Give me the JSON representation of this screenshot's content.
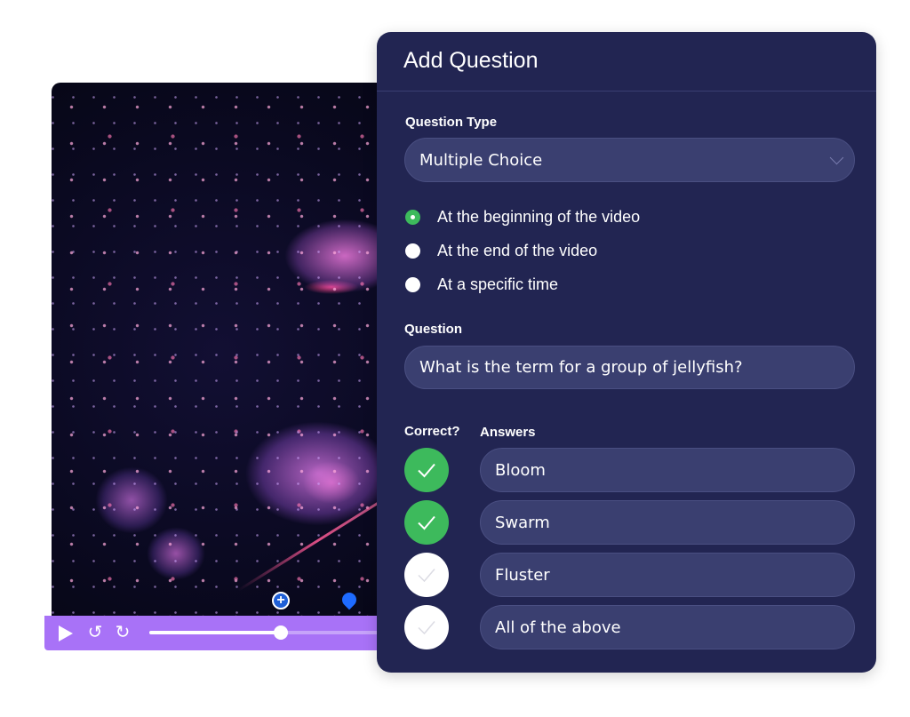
{
  "video": {
    "controls": {
      "play_icon": "play-icon",
      "rewind_icon": "rotate-ccw-icon",
      "forward_icon": "rotate-cw-icon",
      "rewind_glyph": "↺",
      "forward_glyph": "↻",
      "progress_fraction": 0.51
    },
    "markers": [
      {
        "type": "add-question-marker",
        "glyph": "+"
      },
      {
        "type": "question-pin-marker"
      }
    ]
  },
  "panel": {
    "title": "Add Question",
    "question_type": {
      "label": "Question Type",
      "selected": "Multiple Choice"
    },
    "timing_options": [
      {
        "label": "At the beginning of the video",
        "selected": true
      },
      {
        "label": "At the end of the video",
        "selected": false
      },
      {
        "label": "At a specific time",
        "selected": false
      }
    ],
    "question": {
      "label": "Question",
      "value": "What is the term for a group of jellyfish?"
    },
    "correct_header": "Correct?",
    "answers_header": "Answers",
    "answers": [
      {
        "text": "Bloom",
        "correct": true
      },
      {
        "text": "Swarm",
        "correct": true
      },
      {
        "text": "Fluster",
        "correct": false
      },
      {
        "text": "All of the above",
        "correct": false
      }
    ]
  },
  "colors": {
    "panel_bg": "#222552",
    "field_bg": "#3a3f70",
    "accent_green": "#3dba5c",
    "control_bar": "#a872f7",
    "marker_blue": "#1e6bff"
  }
}
